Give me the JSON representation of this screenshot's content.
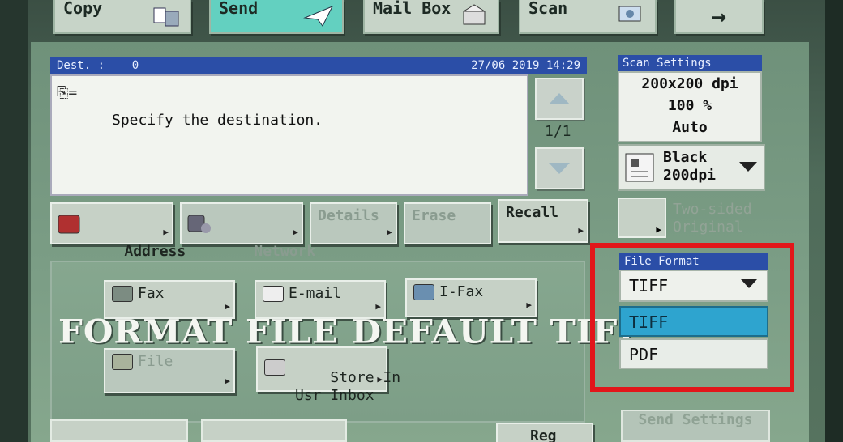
{
  "tabs": [
    {
      "label": "Copy",
      "icon": "copy-icon"
    },
    {
      "label": "Send",
      "icon": "paper-plane-icon"
    },
    {
      "label": "Mail Box",
      "icon": "mailbox-icon"
    },
    {
      "label": "Scan",
      "icon": "scan-icon"
    }
  ],
  "next_arrow": "→",
  "destination": {
    "label": "Dest. :",
    "count": "0",
    "datetime": "27/06 2019 14:29",
    "eq": "=",
    "hint": "Specify the destination.",
    "page": "1/1"
  },
  "dest_buttons": [
    {
      "label": "Address\nBook",
      "enabled": true
    },
    {
      "label": "Network\nAdd.Book",
      "enabled": false
    },
    {
      "label": "Details",
      "enabled": false
    },
    {
      "label": "Erase",
      "enabled": false
    },
    {
      "label": "Recall",
      "enabled": true
    }
  ],
  "scan_settings": {
    "title": "Scan Settings",
    "resolution": "200x200 dpi",
    "zoom": "100 %",
    "mode": "Auto",
    "color_line1": "Black",
    "color_line2": "200dpi"
  },
  "two_sided": {
    "line1": "Two-sided",
    "line2": "Original"
  },
  "file_format": {
    "title": "File Format",
    "selected": "TIFF",
    "options": [
      "TIFF",
      "PDF"
    ]
  },
  "send_types": [
    {
      "label": "Fax"
    },
    {
      "label": "E-mail"
    },
    {
      "label": "I-Fax"
    },
    {
      "label": "File"
    },
    {
      "label": "Store In\nUsr Inbox"
    }
  ],
  "overlay_caption": "FORMAT FILE DEFAULT TIFF",
  "send_settings": "Send Settings",
  "reg_button": "Reg",
  "colors": {
    "accent_blue": "#2b4ea7",
    "active_tab": "#63d0c0",
    "highlight_frame": "#e2161a",
    "selected_option": "#2ea4cf"
  }
}
